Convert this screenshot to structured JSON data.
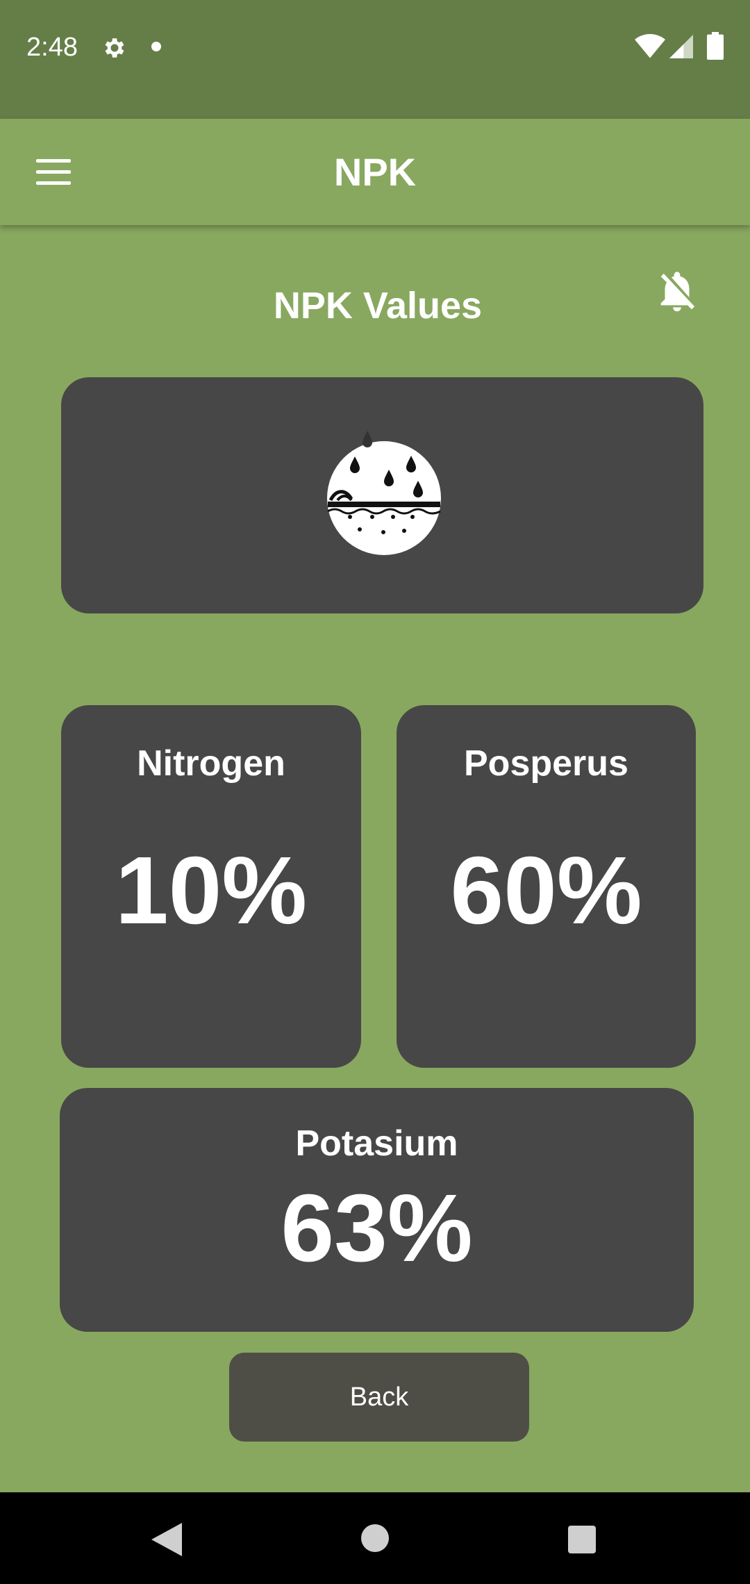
{
  "status_bar": {
    "time": "2:48",
    "icons": [
      "settings-gear-icon",
      "notification-dot-icon",
      "wifi-icon",
      "cell-signal-icon",
      "battery-icon"
    ]
  },
  "app_bar": {
    "title": "NPK",
    "menu_icon": "hamburger-menu-icon"
  },
  "page": {
    "title": "NPK Values",
    "bell_icon": "bell-off-icon",
    "soil_icon": "soil-rain-icon"
  },
  "cards": {
    "nitrogen": {
      "label": "Nitrogen",
      "value": "10%"
    },
    "phosphorus": {
      "label": "Posperus",
      "value": "60%"
    },
    "potassium": {
      "label": "Potasium",
      "value": "63%"
    }
  },
  "back_button": {
    "label": "Back"
  },
  "nav_bar": {
    "icons": [
      "nav-back-icon",
      "nav-home-icon",
      "nav-recents-icon"
    ]
  },
  "colors": {
    "background": "#88a85f",
    "status_bar": "#657e48",
    "card": "#474747",
    "button": "#4e4e46",
    "text": "#ffffff"
  }
}
